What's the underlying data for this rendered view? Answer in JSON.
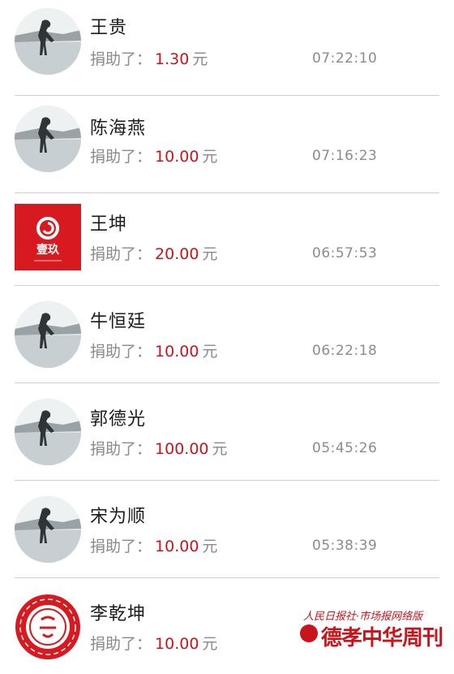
{
  "donation_prefix": "捐助了：",
  "unit": "元",
  "donations": [
    {
      "name": "王贵",
      "amount": "1.30",
      "time": "07:22:10",
      "avatar": "photo-avatar-icon"
    },
    {
      "name": "陈海燕",
      "amount": "10.00",
      "time": "07:16:23",
      "avatar": "photo-avatar-icon"
    },
    {
      "name": "王坤",
      "amount": "20.00",
      "time": "06:57:53",
      "avatar": "yijiu-logo-icon",
      "logo_text": "壹玖"
    },
    {
      "name": "牛恒廷",
      "amount": "10.00",
      "time": "06:22:18",
      "avatar": "photo-avatar-icon"
    },
    {
      "name": "郭德光",
      "amount": "100.00",
      "time": "05:45:26",
      "avatar": "photo-avatar-icon"
    },
    {
      "name": "宋为顺",
      "amount": "10.00",
      "time": "05:38:39",
      "avatar": "photo-avatar-icon"
    },
    {
      "name": "李乾坤",
      "amount": "10.00",
      "time": "",
      "avatar": "seal-avatar-icon"
    }
  ],
  "watermark": {
    "line1": "人民日报社·市场报网络版",
    "line2": "德孝中华周刊"
  },
  "colors": {
    "amount": "#c9141b",
    "label": "#8a8a8a",
    "divider": "#cfcfcf",
    "logo_red": "#d71920"
  }
}
